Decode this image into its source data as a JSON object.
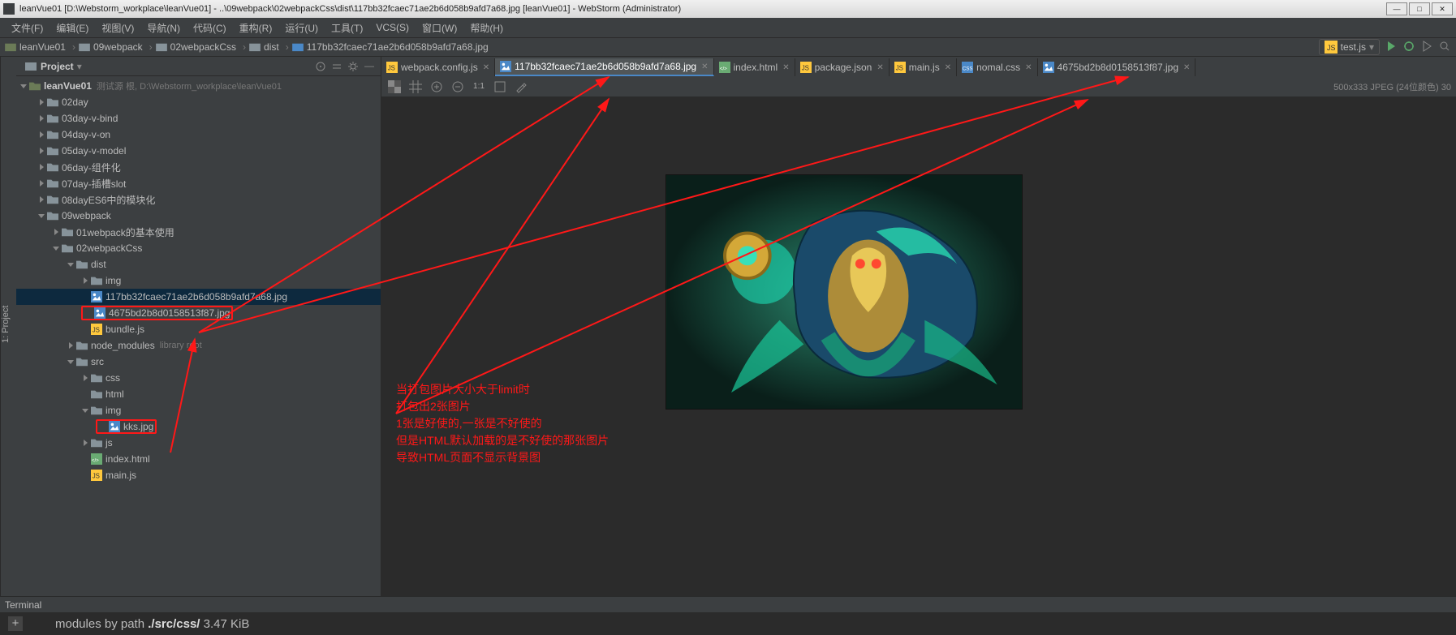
{
  "titlebar": {
    "text": "leanVue01 [D:\\Webstorm_workplace\\leanVue01] - ..\\09webpack\\02webpackCss\\dist\\117bb32fcaec71ae2b6d058b9afd7a68.jpg [leanVue01] - WebStorm (Administrator)"
  },
  "menu": [
    "文件(F)",
    "编辑(E)",
    "视图(V)",
    "导航(N)",
    "代码(C)",
    "重构(R)",
    "运行(U)",
    "工具(T)",
    "VCS(S)",
    "窗口(W)",
    "帮助(H)"
  ],
  "breadcrumb": [
    "leanVue01",
    "09webpack",
    "02webpackCss",
    "dist",
    "117bb32fcaec71ae2b6d058b9afd7a68.jpg"
  ],
  "run_config": "test.js",
  "project": {
    "label": "Project",
    "root": "leanVue01",
    "root_tail": "测试源 根, D:\\Webstorm_workplace\\leanVue01",
    "tree": [
      {
        "d": 1,
        "a": "r",
        "i": "f",
        "t": "02day"
      },
      {
        "d": 1,
        "a": "r",
        "i": "f",
        "t": "03day-v-bind"
      },
      {
        "d": 1,
        "a": "r",
        "i": "f",
        "t": "04day-v-on"
      },
      {
        "d": 1,
        "a": "r",
        "i": "f",
        "t": "05day-v-model"
      },
      {
        "d": 1,
        "a": "r",
        "i": "f",
        "t": "06day-组件化"
      },
      {
        "d": 1,
        "a": "r",
        "i": "f",
        "t": "07day-插槽slot"
      },
      {
        "d": 1,
        "a": "r",
        "i": "f",
        "t": "08dayES6中的模块化"
      },
      {
        "d": 1,
        "a": "d",
        "i": "f",
        "t": "09webpack"
      },
      {
        "d": 2,
        "a": "r",
        "i": "f",
        "t": "01webpack的基本使用"
      },
      {
        "d": 2,
        "a": "d",
        "i": "f",
        "t": "02webpackCss"
      },
      {
        "d": 3,
        "a": "d",
        "i": "f",
        "t": "dist"
      },
      {
        "d": 4,
        "a": "r",
        "i": "f",
        "t": "img"
      },
      {
        "d": 4,
        "a": "",
        "i": "img",
        "t": "117bb32fcaec71ae2b6d058b9afd7a68.jpg",
        "sel": true
      },
      {
        "d": 4,
        "a": "",
        "i": "img",
        "t": "4675bd2b8d0158513f87.jpg",
        "box": true
      },
      {
        "d": 4,
        "a": "",
        "i": "js",
        "t": "bundle.js"
      },
      {
        "d": 3,
        "a": "r",
        "i": "f",
        "t": "node_modules",
        "tail": "library root"
      },
      {
        "d": 3,
        "a": "d",
        "i": "f",
        "t": "src"
      },
      {
        "d": 4,
        "a": "r",
        "i": "f",
        "t": "css"
      },
      {
        "d": 4,
        "a": "",
        "i": "f",
        "t": "html"
      },
      {
        "d": 4,
        "a": "d",
        "i": "f",
        "t": "img"
      },
      {
        "d": 5,
        "a": "",
        "i": "img",
        "t": "kks.jpg",
        "box": true
      },
      {
        "d": 4,
        "a": "r",
        "i": "f",
        "t": "js"
      },
      {
        "d": 4,
        "a": "",
        "i": "html",
        "t": "index.html"
      },
      {
        "d": 4,
        "a": "",
        "i": "js",
        "t": "main.js"
      }
    ]
  },
  "tabs": [
    {
      "i": "js",
      "t": "webpack.config.js"
    },
    {
      "i": "img",
      "t": "117bb32fcaec71ae2b6d058b9afd7a68.jpg",
      "active": true
    },
    {
      "i": "html",
      "t": "index.html"
    },
    {
      "i": "js",
      "t": "package.json"
    },
    {
      "i": "js",
      "t": "main.js"
    },
    {
      "i": "css",
      "t": "nomal.css"
    },
    {
      "i": "img",
      "t": "4675bd2b8d0158513f87.jpg"
    }
  ],
  "viewer": {
    "toolbar_11": "1:1",
    "info": "500x333 JPEG (24位颜色) 30"
  },
  "annotation": [
    "当打包图片大小大于limit时",
    "打包出2张图片",
    "1张是好使的,一张是不好使的",
    "但是HTML默认加载的是不好使的那张图片",
    "导致HTML页面不显示背景图"
  ],
  "terminal": {
    "label": "Terminal",
    "line_pre": "modules by path ",
    "line_bold": "./src/css/",
    "line_post": " 3.47 KiB"
  },
  "sidetab": "1: Project"
}
